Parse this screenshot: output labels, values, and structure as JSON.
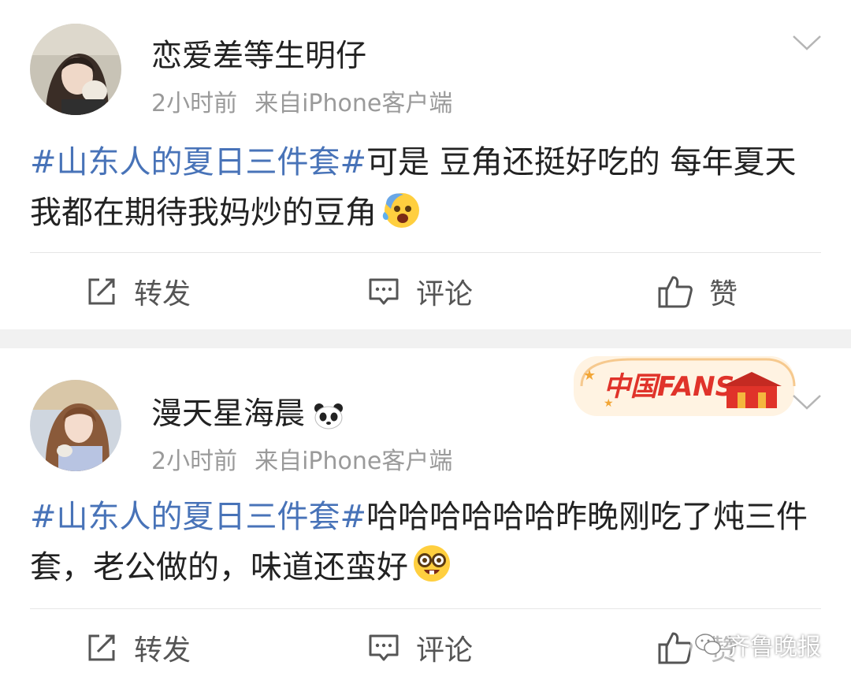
{
  "posts": [
    {
      "username": "恋爱差等生明仔",
      "time": "2小时前",
      "source": "来自iPhone客户端",
      "hashtag": "#山东人的夏日三件套#",
      "text": "可是 豆角还挺好吃的 每年夏天我都在期待我妈炒的豆角",
      "emoji": "hot-face-emoji",
      "actions": {
        "repost": "转发",
        "comment": "评论",
        "like": "赞"
      }
    },
    {
      "username": "漫天星海晨",
      "time": "2小时前",
      "source": "来自iPhone客户端",
      "hashtag": "#山东人的夏日三件套#",
      "text": "哈哈哈哈哈哈昨晚刚吃了炖三件套，老公做的，味道还蛮好",
      "emoji": "nerd-face-emoji",
      "badge_text": "中国FANS",
      "actions": {
        "repost": "转发",
        "comment": "评论",
        "like": "赞"
      }
    }
  ],
  "watermark": "齐鲁晚报",
  "colors": {
    "hashtag": "#4873b8",
    "meta": "#9a9a9a",
    "separator": "#f1f1f1",
    "badge": "#e0332a"
  }
}
